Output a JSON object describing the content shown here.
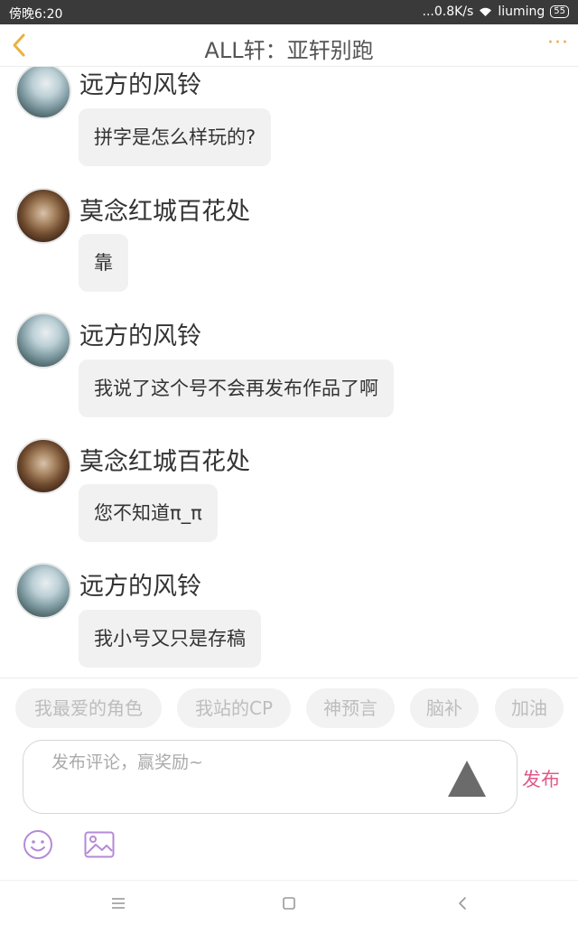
{
  "status_bar": {
    "time": "傍晚6:20",
    "network": "...0.8K/s",
    "wifi_name": "liuming",
    "battery": "55"
  },
  "header": {
    "title": "ALL轩：亚轩别跑",
    "back_icon": "chevron-left-icon",
    "more_icon": "more-dots-icon",
    "accent_color": "#f2a33a"
  },
  "messages": [
    {
      "user": "远方的风铃",
      "text": "拼字是怎么样玩的?",
      "avatar": "avatar-misty-forest"
    },
    {
      "user": "莫念红城百花处",
      "text": "靠",
      "avatar": "avatar-dark-floral"
    },
    {
      "user": "远方的风铃",
      "text": "我说了这个号不会再发布作品了啊",
      "avatar": "avatar-misty-forest"
    },
    {
      "user": "莫念红城百花处",
      "text": "您不知道π_π",
      "avatar": "avatar-dark-floral"
    },
    {
      "user": "远方的风铃",
      "text": "我小号又只是存稿",
      "avatar": "avatar-misty-forest"
    }
  ],
  "quick_tags": [
    "我最爱的角色",
    "我站的CP",
    "神预言",
    "脑补",
    "加油"
  ],
  "composer": {
    "placeholder": "发布评论，赢奖励~",
    "publish_label": "发布",
    "publish_color": "#e05a8a",
    "emoji_icon": "smiley-icon",
    "image_icon": "image-icon",
    "tool_color": "#b58ad6"
  },
  "system_nav": [
    "menu-icon",
    "home-square-icon",
    "back-icon"
  ]
}
